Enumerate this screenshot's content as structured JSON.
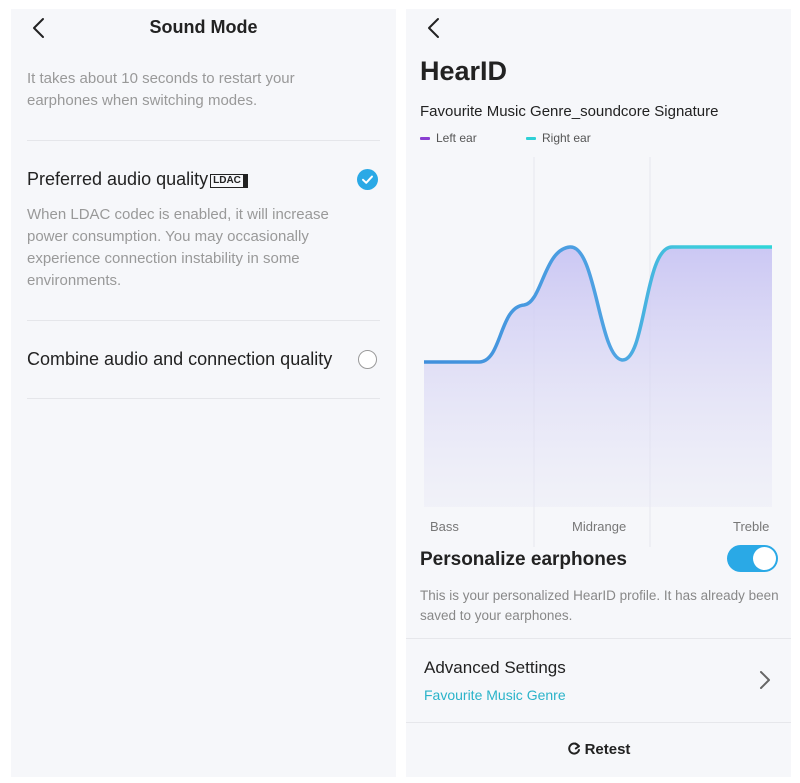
{
  "sound_mode": {
    "title": "Sound Mode",
    "description": "It takes about 10 seconds to restart your earphones when switching modes.",
    "options": [
      {
        "label": "Preferred audio quality",
        "badge": "LDAC",
        "description": "When LDAC codec is enabled, it will increase power consumption. You may occasionally experience connection instability in some environments.",
        "selected": true
      },
      {
        "label": "Combine audio and connection quality",
        "selected": false
      }
    ]
  },
  "hearid": {
    "title": "HearID",
    "genre_label": "Favourite Music Genre_soundcore Signature",
    "personalize": {
      "title": "Personalize earphones",
      "enabled": true,
      "description": "This is your personalized HearID profile. It has already been saved to your earphones."
    },
    "advanced": {
      "title": "Advanced Settings",
      "subtitle": "Favourite Music Genre"
    },
    "retest_label": "Retest"
  },
  "colors": {
    "accent": "#2aa9e6",
    "left_ear": "#8a3fd1",
    "right_ear": "#2fd0d6",
    "teal_text": "#2ab3c9"
  },
  "chart_data": {
    "type": "area",
    "series": [
      {
        "name": "Left ear",
        "color": "#8a3fd1"
      },
      {
        "name": "Right ear",
        "color": "#2fd0d6"
      }
    ],
    "categories": [
      "Bass",
      "Midrange",
      "Treble"
    ]
  }
}
